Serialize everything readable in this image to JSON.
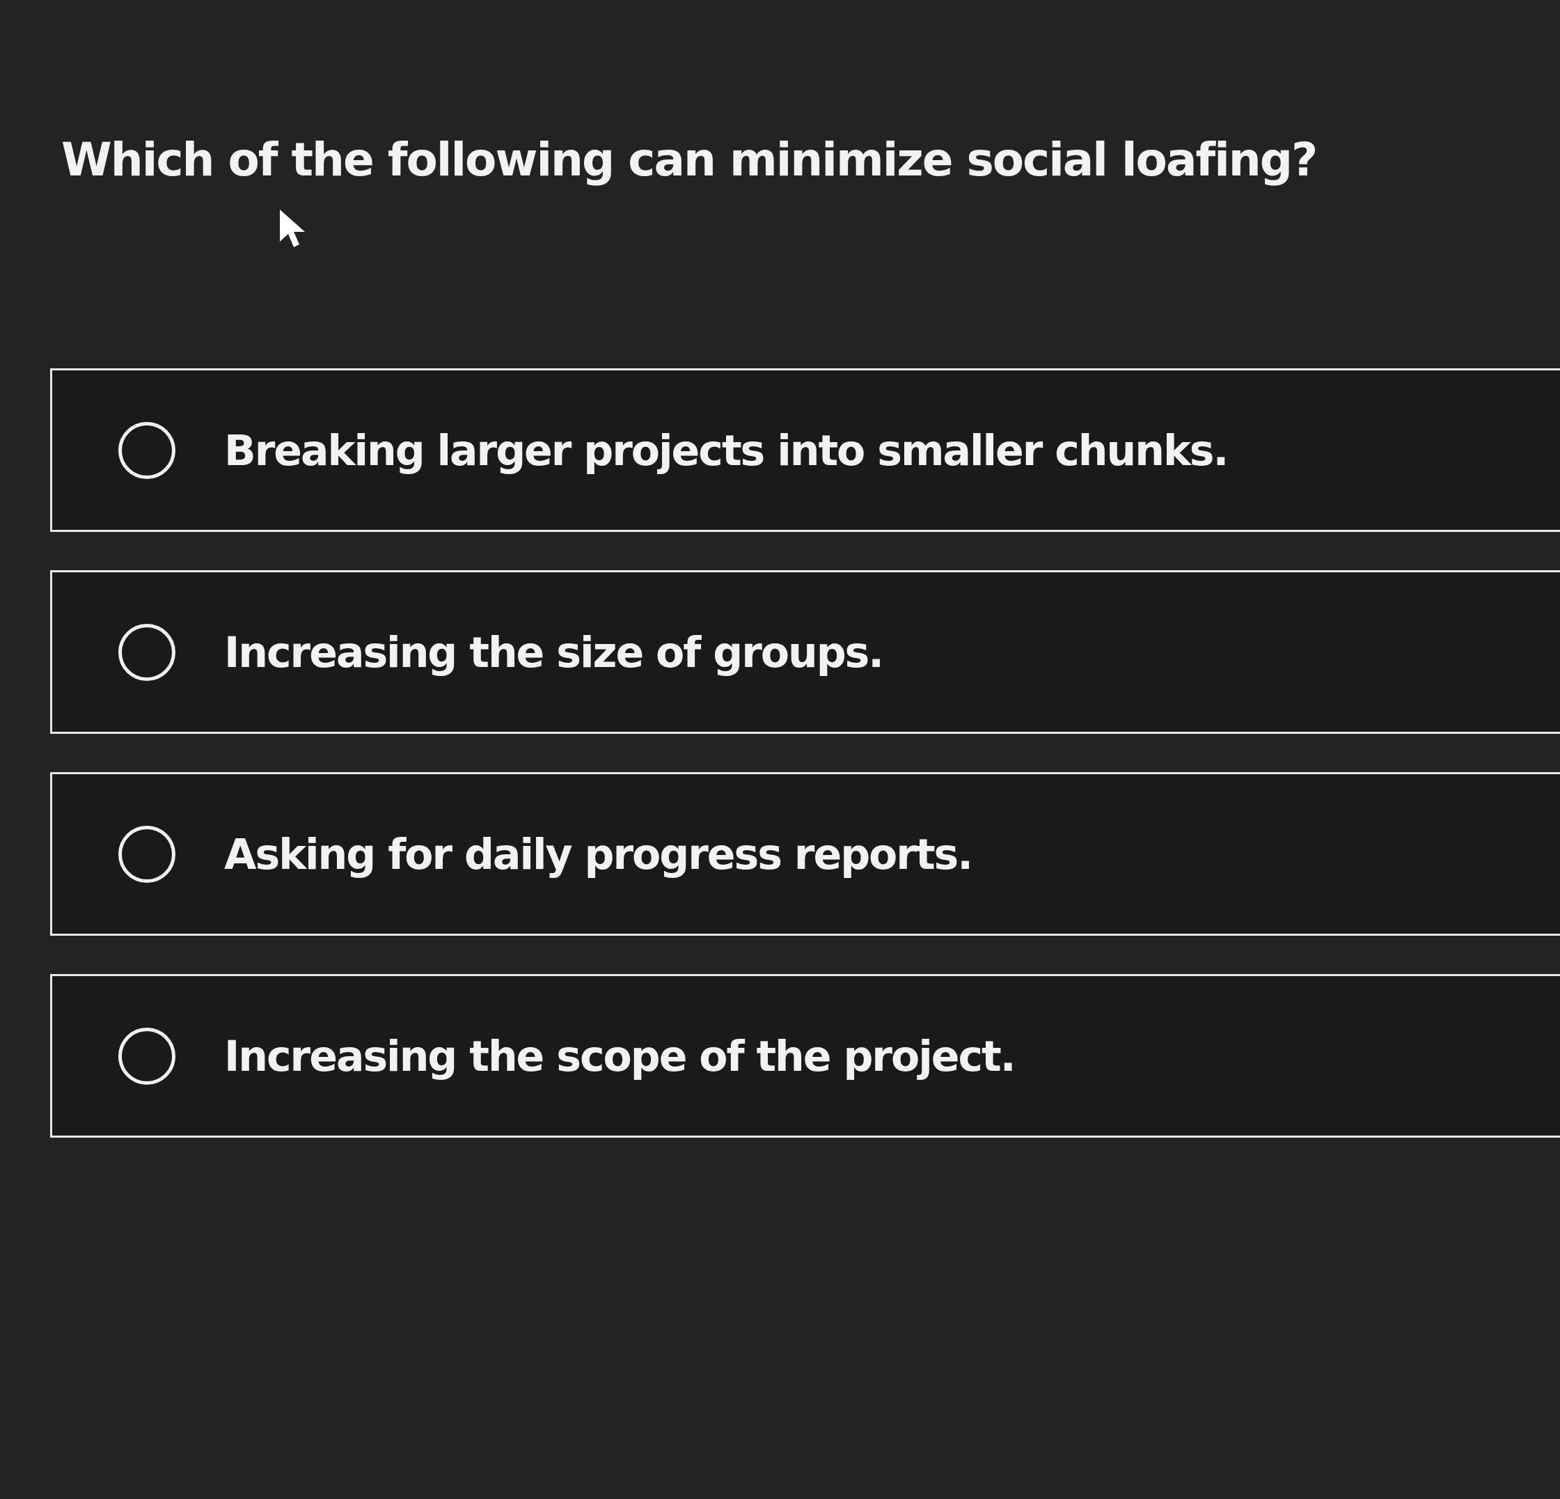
{
  "question": "Which of the following can minimize social loafing?",
  "options": [
    {
      "label": "Breaking larger projects into smaller chunks.",
      "selected": false
    },
    {
      "label": "Increasing the size of groups.",
      "selected": false
    },
    {
      "label": "Asking for daily progress reports.",
      "selected": false
    },
    {
      "label": "Increasing the scope of the project.",
      "selected": false
    }
  ]
}
